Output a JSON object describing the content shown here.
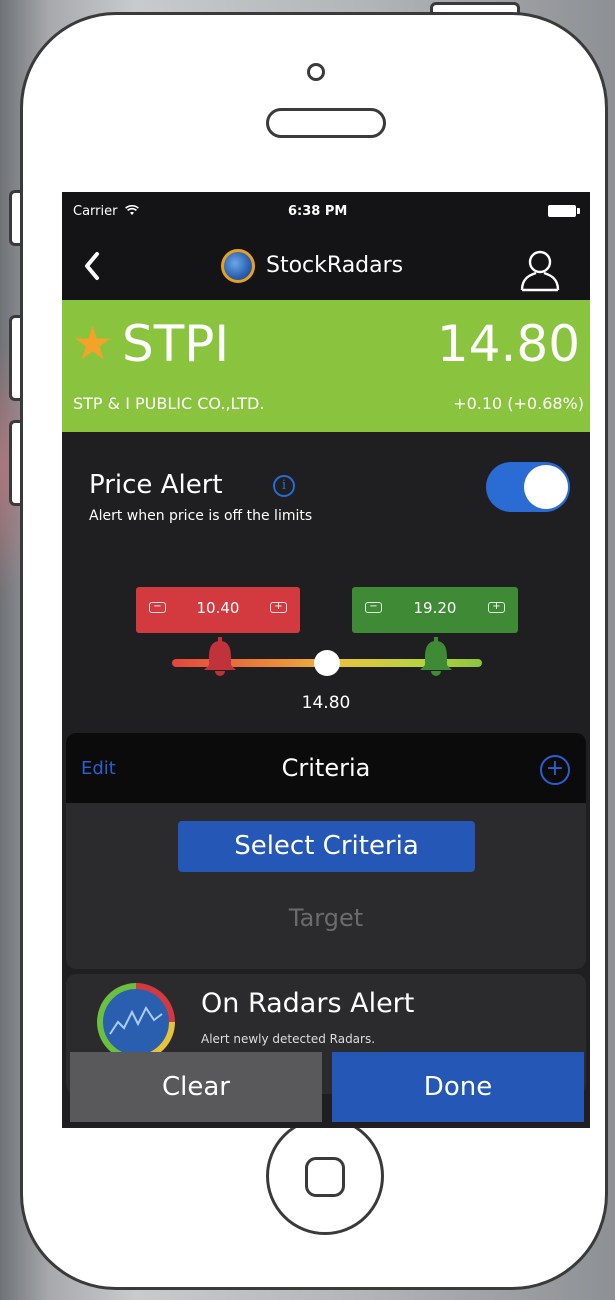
{
  "status_bar": {
    "carrier": "Carrier",
    "time": "6:38 PM"
  },
  "nav": {
    "title": "StockRadars",
    "back_icon": "chevron-left-icon",
    "user_icon": "user-icon"
  },
  "stock": {
    "symbol": "STPI",
    "price": "14.80",
    "company": "STP & I PUBLIC CO.,LTD.",
    "change": "+0.10 (+0.68%)",
    "favorite_icon": "star-icon",
    "banner_color": "#8ac43f"
  },
  "price_alert": {
    "title": "Price Alert",
    "subtitle": "Alert when price is off the limits",
    "enabled": true,
    "toggle_color": "#2a6bd4"
  },
  "limits": {
    "low": "10.40",
    "high": "19.20",
    "current": "14.80",
    "low_color": "#d23a3f",
    "high_color": "#3f8a35"
  },
  "criteria": {
    "edit_label": "Edit",
    "title": "Criteria",
    "select_label": "Select Criteria",
    "target_label": "Target"
  },
  "radars_alert": {
    "title": "On Radars Alert",
    "subtitle": "Alert newly detected Radars."
  },
  "actions": {
    "clear_label": "Clear",
    "done_label": "Done",
    "done_color": "#2457b6"
  }
}
